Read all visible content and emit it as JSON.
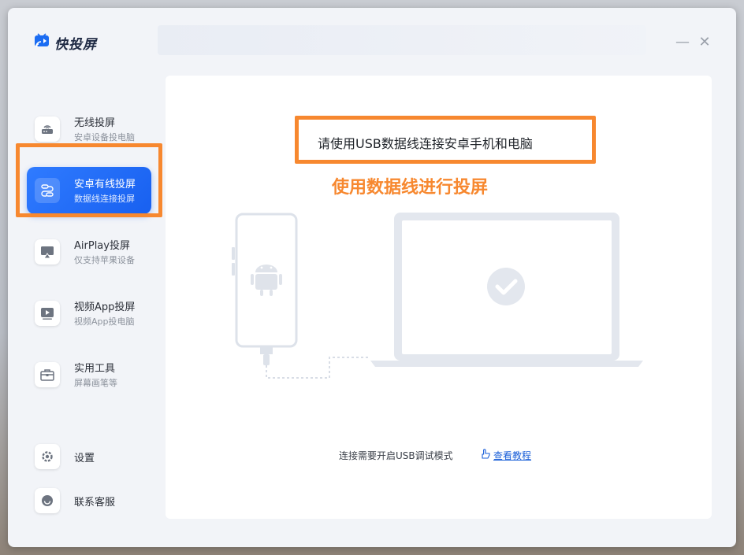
{
  "app": {
    "title": "快投屏",
    "controls": {
      "minimize": "—",
      "close": "✕"
    }
  },
  "sidebar": {
    "items": [
      {
        "title": "无线投屏",
        "subtitle": "安卓设备投电脑",
        "icon": "wifi-router-icon"
      },
      {
        "title": "安卓有线投屏",
        "subtitle": "数据线连接投屏",
        "icon": "cable-icon",
        "active": true
      },
      {
        "title": "AirPlay投屏",
        "subtitle": "仅支持苹果设备",
        "icon": "airplay-icon"
      },
      {
        "title": "视频App投屏",
        "subtitle": "视频App投电脑",
        "icon": "video-app-icon"
      },
      {
        "title": "实用工具",
        "subtitle": "屏幕画笔等",
        "icon": "toolbox-icon"
      }
    ],
    "bottom": [
      {
        "title": "设置",
        "icon": "gear-icon"
      },
      {
        "title": "联系客服",
        "icon": "chat-icon"
      }
    ]
  },
  "main": {
    "instruction": "请使用USB数据线连接安卓手机和电脑",
    "annotation": "使用数据线进行投屏",
    "footer_text": "连接需要开启USB调试模式",
    "tutorial_link": "查看教程"
  },
  "colors": {
    "accent": "#1860f0",
    "highlight": "#f7882f",
    "illustration": "#e3e7ee"
  }
}
